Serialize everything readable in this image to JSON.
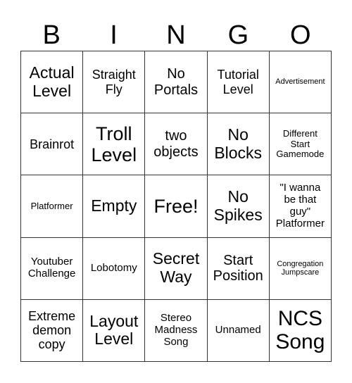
{
  "header": {
    "letters": [
      "B",
      "I",
      "N",
      "G",
      "O"
    ]
  },
  "grid": {
    "rows": [
      [
        "Actual\nLevel",
        "Straight\nFly",
        "No\nPortals",
        "Tutorial\nLevel",
        "Advertisement"
      ],
      [
        "Brainrot",
        "Troll\nLevel",
        "two\nobjects",
        "No\nBlocks",
        "Different\nStart\nGamemode"
      ],
      [
        "Platformer",
        "Empty",
        "Free!",
        "No\nSpikes",
        "\"I wanna\nbe that\nguy\"\nPlatformer"
      ],
      [
        "Youtuber\nChallenge",
        "Lobotomy",
        "Secret\nWay",
        "Start\nPosition",
        "Congregation\nJumpscare"
      ],
      [
        "Extreme\ndemon\ncopy",
        "Layout\nLevel",
        "Stereo\nMadness\nSong",
        "Unnamed",
        "NCS\nSong"
      ]
    ]
  }
}
